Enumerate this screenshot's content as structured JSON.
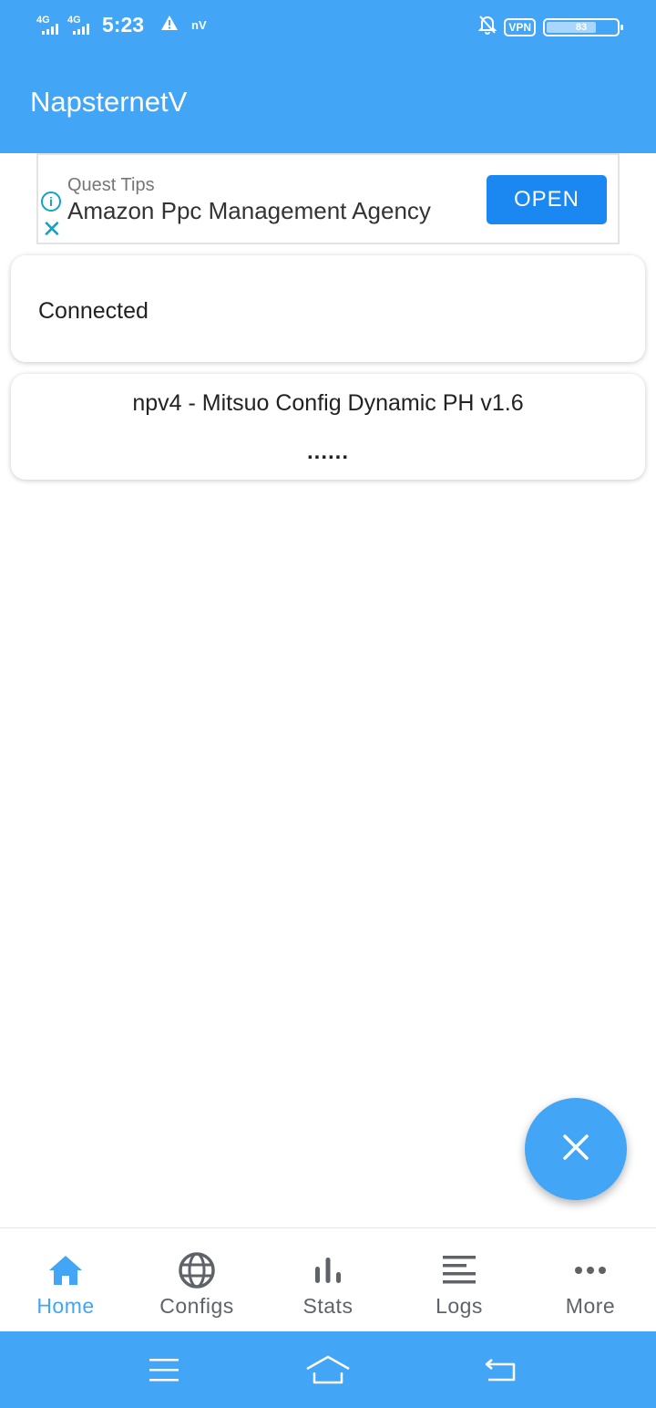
{
  "status_bar": {
    "sim1": "4G",
    "sim2": "4G",
    "time": "5:23",
    "notif_text": "nV",
    "vpn": "VPN",
    "battery": "83"
  },
  "app_bar": {
    "title": "NapsternetV"
  },
  "ad": {
    "source": "Quest Tips",
    "headline": "Amazon Ppc Management Agency",
    "button": "OPEN",
    "info_glyph": "i"
  },
  "status_card": {
    "text": "Connected"
  },
  "config_card": {
    "name": "npv4 - Mitsuo Config Dynamic PH v1.6",
    "detail": "......"
  },
  "bottom_nav": {
    "items": [
      {
        "label": "Home",
        "icon": "home-icon",
        "active": true
      },
      {
        "label": "Configs",
        "icon": "globe-icon",
        "active": false
      },
      {
        "label": "Stats",
        "icon": "bar-chart-icon",
        "active": false
      },
      {
        "label": "Logs",
        "icon": "list-icon",
        "active": false
      },
      {
        "label": "More",
        "icon": "more-horizontal-icon",
        "active": false
      }
    ]
  },
  "colors": {
    "primary": "#42a5f5",
    "ad_button": "#1a88f0",
    "ad_icon": "#11a3c4",
    "nav_inactive": "#5f6368"
  }
}
